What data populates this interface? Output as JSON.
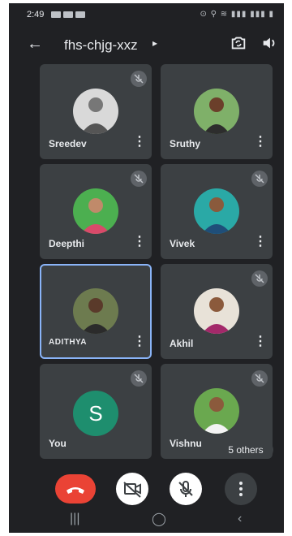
{
  "status_bar": {
    "time": "2:49",
    "right_indicators": "⊙ ⚲ ≋ ▮▮▮ ▮▮▮ ▮"
  },
  "header": {
    "meeting_code": "fhs-chjg-xxz",
    "caret": "▸"
  },
  "participants": [
    {
      "name": "Sreedev",
      "muted": true
    },
    {
      "name": "Sruthy",
      "muted": false
    },
    {
      "name": "Deepthi",
      "muted": true
    },
    {
      "name": "Vivek",
      "muted": true
    },
    {
      "name": "ADITHYA",
      "muted": false,
      "active_speaker": true
    },
    {
      "name": "Akhil",
      "muted": true
    },
    {
      "name": "You",
      "muted": true,
      "avatar_letter": "S"
    },
    {
      "name": "Vishnu",
      "muted": true
    }
  ],
  "others_badge": "5 others",
  "colors": {
    "background": "#202124",
    "tile": "#3c4043",
    "end_call": "#ea4335",
    "active_border": "#8ab4f8",
    "letter_avatar": "#1e8e6e"
  }
}
